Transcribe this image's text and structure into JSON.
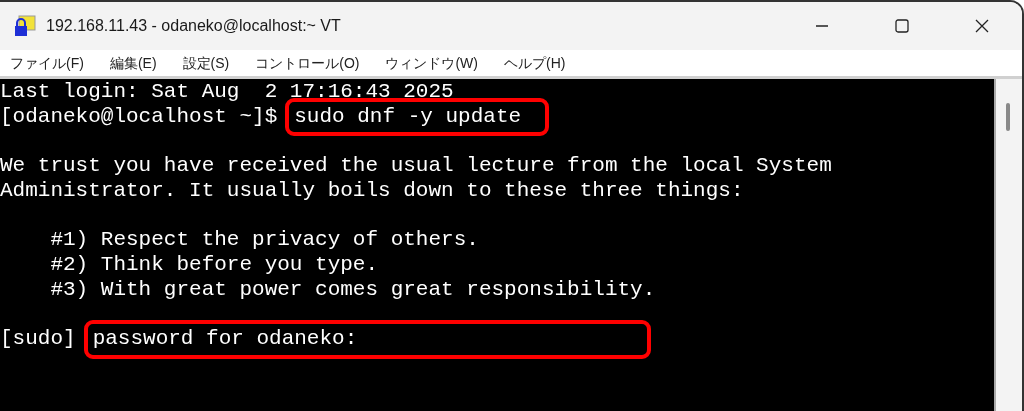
{
  "window": {
    "title": "192.168.11.43 - odaneko@localhost:~ VT"
  },
  "menu": [
    "ファイル(F)",
    "編集(E)",
    "設定(S)",
    "コントロール(O)",
    "ウィンドウ(W)",
    "ヘルプ(H)"
  ],
  "terminal": {
    "lines": [
      {
        "space_before": false,
        "segments": [
          {
            "text": "Last login: Sat Aug  2 17:16:43 2025",
            "highlighted": false
          }
        ]
      },
      {
        "space_before": false,
        "segments": [
          {
            "text": "[odaneko@localhost ~]$",
            "highlighted": false
          },
          {
            "text": "sudo dnf -y update",
            "highlighted": true
          }
        ]
      },
      {
        "space_before": true,
        "segments": [
          {
            "text": "We trust you have received the usual lecture from the local System",
            "highlighted": false
          }
        ]
      },
      {
        "space_before": false,
        "segments": [
          {
            "text": "Administrator. It usually boils down to these three things:",
            "highlighted": false
          }
        ]
      },
      {
        "space_before": true,
        "segments": [
          {
            "text": "    #1) Respect the privacy of others.",
            "highlighted": false
          }
        ]
      },
      {
        "space_before": false,
        "segments": [
          {
            "text": "    #2) Think before you type.",
            "highlighted": false
          }
        ]
      },
      {
        "space_before": false,
        "segments": [
          {
            "text": "    #3) With great power comes great responsibility.",
            "highlighted": false
          }
        ]
      },
      {
        "space_before": true,
        "segments": [
          {
            "text": "[sudo]",
            "highlighted": false
          },
          {
            "text": "password for odaneko:",
            "highlighted": true
          }
        ]
      }
    ]
  }
}
